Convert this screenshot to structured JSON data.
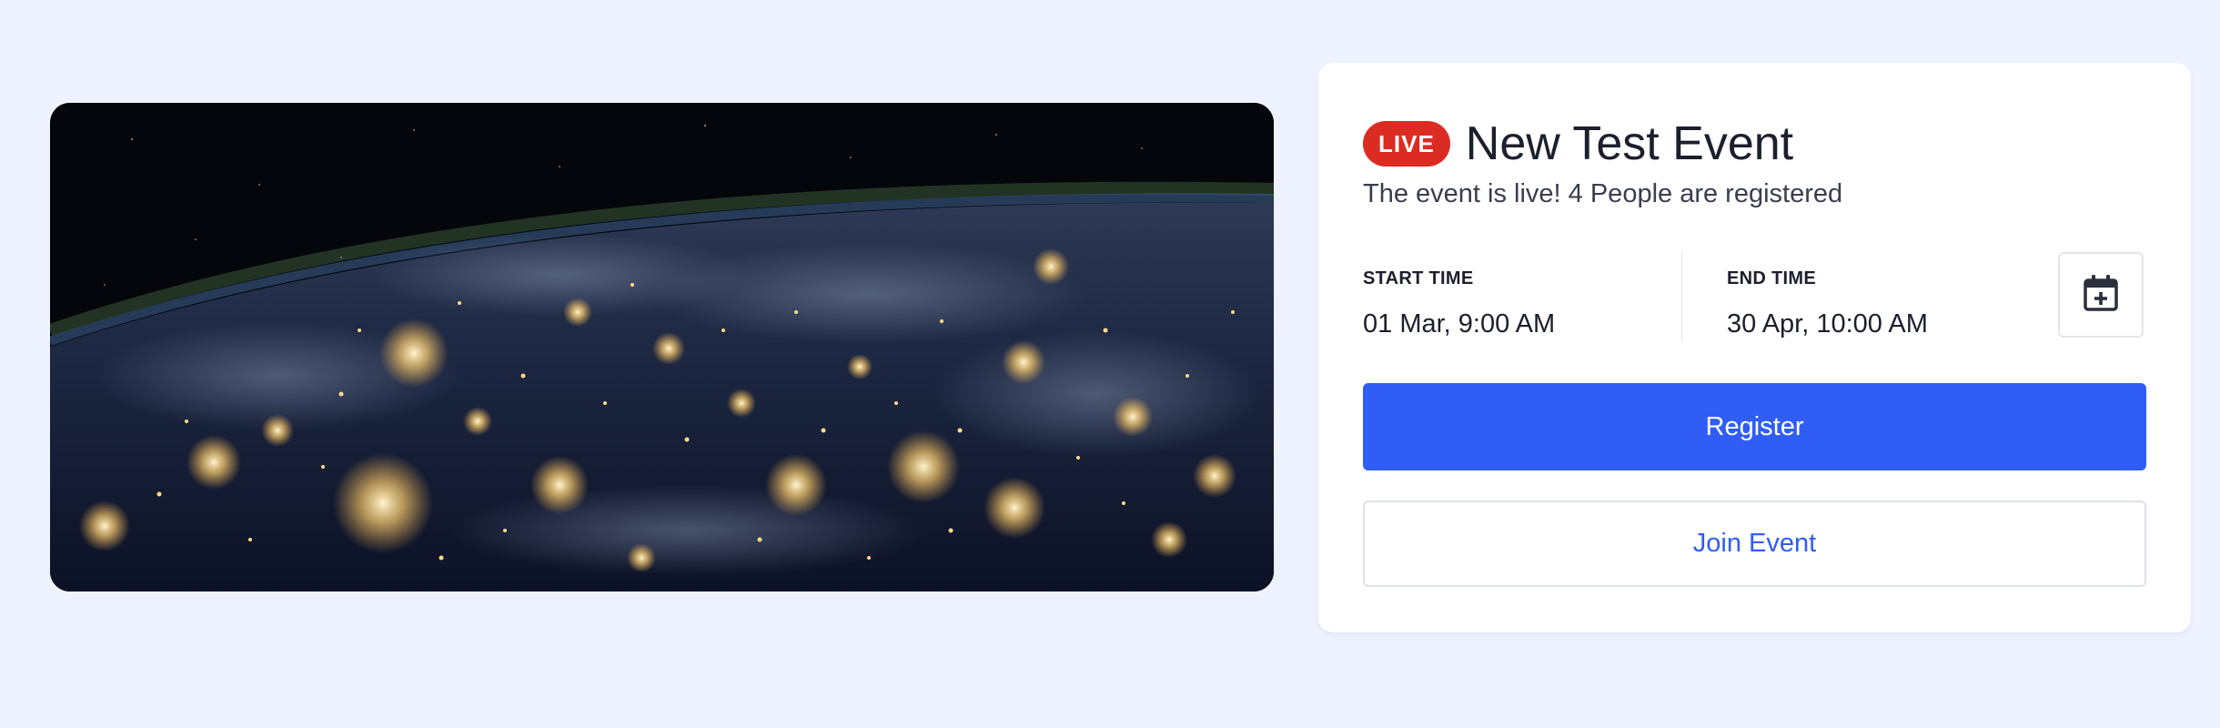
{
  "event": {
    "status_badge": "LIVE",
    "title": "New Test Event",
    "status_message": "The event is live! 4 People are registered"
  },
  "schedule": {
    "start_label": "START TIME",
    "start_value": "01 Mar, 9:00 AM",
    "end_label": "END TIME",
    "end_value": "30 Apr, 10:00 AM"
  },
  "actions": {
    "register_label": "Register",
    "join_label": "Join Event"
  },
  "icons": {
    "calendar": "calendar-plus-icon"
  },
  "colors": {
    "page_background": "#eef2fe",
    "live_badge": "#dc2b22",
    "primary": "#2f5df5"
  }
}
